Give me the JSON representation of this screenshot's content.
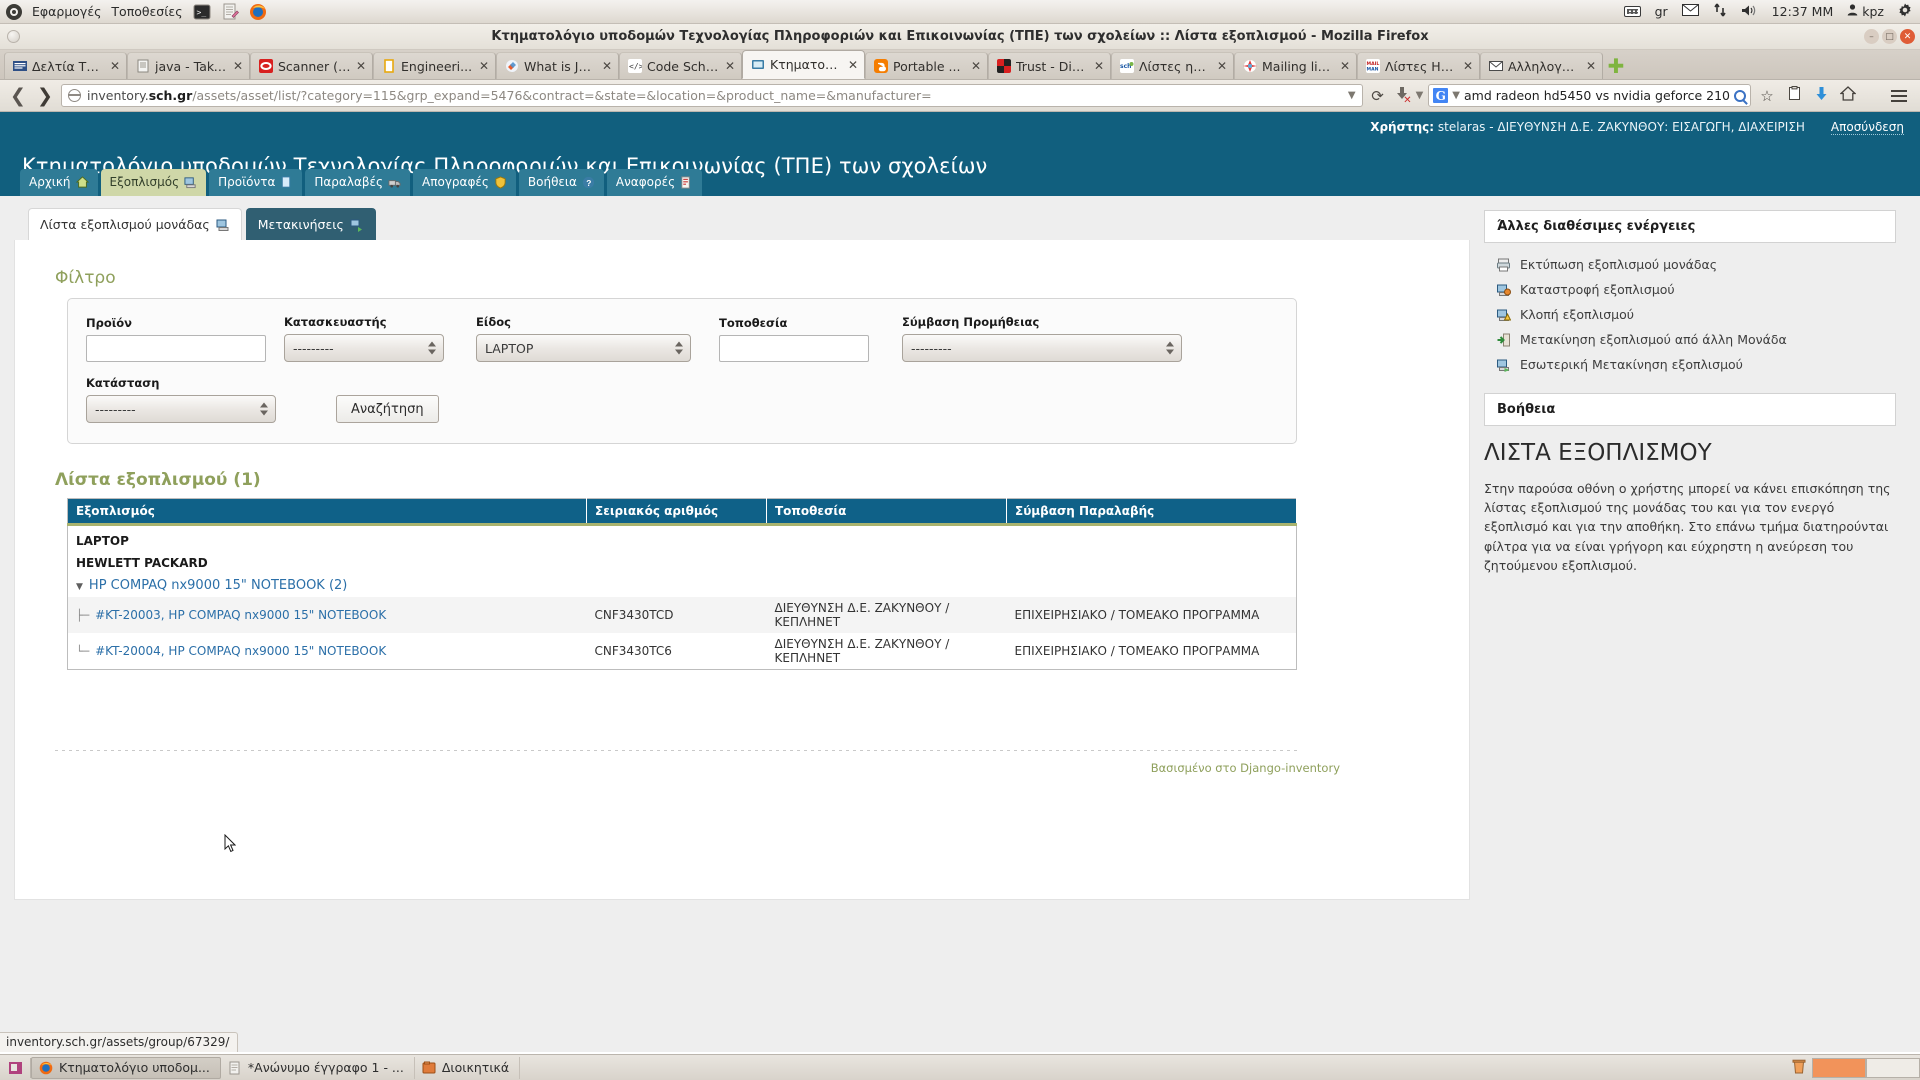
{
  "desktop": {
    "panel": {
      "menus": [
        "Εφαρμογές",
        "Τοποθεσίες"
      ],
      "launchers": [
        {
          "name": "terminal-launcher",
          "label": "Terminal"
        },
        {
          "name": "text-editor-launcher",
          "label": "Text Editor"
        },
        {
          "name": "firefox-launcher",
          "label": "Firefox"
        }
      ],
      "tray": {
        "keyboard_icon": "keyboard-icon",
        "layout": "gr",
        "mail_icon": "mail-icon",
        "network_icon": "network-icon",
        "volume_icon": "volume-icon",
        "clock": "12:37 ΜΜ",
        "user": "kpz",
        "settings_icon": "gear-icon"
      }
    },
    "taskbar": {
      "show_desktop_label": "Show Desktop",
      "items": [
        {
          "label": "Κτηματολόγιο υποδομ...",
          "icon": "firefox-icon",
          "active": true
        },
        {
          "label": "*Ανώνυμο έγγραφο 1 - ...",
          "icon": "text-editor-icon",
          "active": false
        },
        {
          "label": "Διοικητικά",
          "icon": "folder-icon",
          "active": false
        }
      ],
      "workspaces": 2,
      "trash_icon": "trash-icon"
    }
  },
  "browser": {
    "window_title": "Κτηματολόγιο υποδομών Τεχνολογίας Πληροφοριών και Επικοινωνίας (ΤΠΕ) των σχολείων :: Λίστα εξοπλισμού - Mozilla Firefox",
    "window_buttons": {
      "minimize": "–",
      "maximize": "□",
      "close": "✕"
    },
    "tabs": [
      {
        "label": "Δελτία Τε...",
        "favicon": "news-icon",
        "active": false
      },
      {
        "label": "java - Take...",
        "favicon": "doc-icon",
        "active": false
      },
      {
        "label": "Scanner (J...",
        "favicon": "oracle-icon",
        "active": false
      },
      {
        "label": "Engineeri...",
        "favicon": "book-icon",
        "active": false
      },
      {
        "label": "What is Jo...",
        "favicon": "joomla-icon",
        "active": false
      },
      {
        "label": "Code School -...",
        "favicon": "code-icon",
        "active": false
      },
      {
        "label": "Κτηματολόγι...",
        "favicon": "inventory-icon",
        "active": true
      },
      {
        "label": "Portable ...",
        "favicon": "blogger-icon",
        "active": false
      },
      {
        "label": "Trust - Dig...",
        "favicon": "trust-icon",
        "active": false
      },
      {
        "label": "Λίστες ηλε...",
        "favicon": "sch-icon",
        "active": false
      },
      {
        "label": "Mailing lis...",
        "favicon": "mailing-icon",
        "active": false
      },
      {
        "label": "Λίστες Ηλ...",
        "favicon": "mailman-icon",
        "active": false
      },
      {
        "label": "Αλληλογρ...",
        "favicon": "envelope-icon",
        "active": false
      }
    ],
    "tab_close_glyph": "✕",
    "new_tab_glyph": "✚",
    "nav": {
      "back_glyph": "❮",
      "forward_glyph": "❯",
      "reload_glyph": "⟳",
      "stop_glyph": "⬇",
      "bookmark_glyph": "☆",
      "library_glyph": "🗐",
      "download_glyph": "⬇",
      "home_glyph": "⌂",
      "menu_name": "hamburger-menu"
    },
    "url": {
      "scheme_host_prefix": "inventory.",
      "host_strong": "sch.gr",
      "path": "/assets/asset/list/?category=115&grp_expand=5476&contract=&state=&location=&product_name=&manufacturer="
    },
    "search": {
      "engine": "G",
      "value": "amd radeon hd5450 vs nvidia geforce 210",
      "placeholder": "Αναζήτηση"
    },
    "status_bar": "inventory.sch.gr/assets/group/67329/"
  },
  "app": {
    "site_title": "Κτηματολόγιο υποδομών Τεχνολογίας Πληροφοριών και Επικοινωνίας (ΤΠΕ) των σχολείων",
    "user_bar": {
      "label": "Χρήστης:",
      "value": "stelaras - ΔΙΕΥΘΥΝΣΗ Δ.Ε. ΖΑΚΥΝΘΟΥ: ΕΙΣΑΓΩΓΗ, ΔΙΑΧΕΙΡΙΣΗ",
      "logout": "Αποσύνδεση"
    },
    "main_nav": [
      {
        "label": "Αρχική",
        "icon": "home-icon",
        "active": false
      },
      {
        "label": "Εξοπλισμός",
        "icon": "computer-icon",
        "active": true
      },
      {
        "label": "Προϊόντα",
        "icon": "page-icon",
        "active": false
      },
      {
        "label": "Παραλαβές",
        "icon": "truck-icon",
        "active": false
      },
      {
        "label": "Απογραφές",
        "icon": "shield-icon",
        "active": false
      },
      {
        "label": "Βοήθεια",
        "icon": "question-icon",
        "active": false
      },
      {
        "label": "Αναφορές",
        "icon": "report-icon",
        "active": false
      }
    ],
    "sub_tabs": [
      {
        "label": "Λίστα εξοπλισμού μονάδας",
        "icon": "computer-icon",
        "active": true
      },
      {
        "label": "Μετακινήσεις",
        "icon": "transfer-icon",
        "active": false
      }
    ],
    "filter": {
      "title": "Φίλτρο",
      "fields": [
        {
          "name": "product",
          "label": "Προϊόν",
          "type": "text",
          "value": "",
          "placeholder": ""
        },
        {
          "name": "manufacturer",
          "label": "Κατασκευαστής",
          "type": "select",
          "value": "---------"
        },
        {
          "name": "kind",
          "label": "Είδος",
          "type": "select",
          "value": "LAPTOP"
        },
        {
          "name": "location",
          "label": "Τοποθεσία",
          "type": "text",
          "value": "",
          "placeholder": ""
        },
        {
          "name": "supply_contract",
          "label": "Σύμβαση Προμήθειας",
          "type": "select",
          "value": "---------"
        },
        {
          "name": "state",
          "label": "Κατάσταση",
          "type": "select",
          "value": "---------"
        }
      ],
      "search_button": "Αναζήτηση"
    },
    "results": {
      "title": "Λίστα εξοπλισμού (1)",
      "columns": [
        "Εξοπλισμός",
        "Σειριακός αριθμός",
        "Τοποθεσία",
        "Σύμβαση Παραλαβής"
      ],
      "category": "LAPTOP",
      "manufacturer": "HEWLETT PACKARD",
      "product_group": "HP COMPAQ nx9000 15\" NOTEBOOK (2)",
      "rows": [
        {
          "equipment": "#KT-20003, HP COMPAQ nx9000 15\" NOTEBOOK",
          "serial": "CNF3430TCD",
          "location": "ΔΙΕΥΘΥΝΣΗ Δ.Ε. ΖΑΚΥΝΘΟΥ / ΚΕΠΛΗΝΕΤ",
          "contract": "ΕΠΙΧΕΙΡΗΣΙΑΚΟ / ΤΟΜΕΑΚΟ ΠΡΟΓΡΑΜΜΑ"
        },
        {
          "equipment": "#KT-20004, HP COMPAQ nx9000 15\" NOTEBOOK",
          "serial": "CNF3430TC6",
          "location": "ΔΙΕΥΘΥΝΣΗ Δ.Ε. ΖΑΚΥΝΘΟΥ / ΚΕΠΛΗΝΕΤ",
          "contract": "ΕΠΙΧΕΙΡΗΣΙΑΚΟ / ΤΟΜΕΑΚΟ ΠΡΟΓΡΑΜΜΑ"
        }
      ]
    },
    "footer": "Βασισμένο στο Django-inventory",
    "sidebar": {
      "actions_title": "Άλλες διαθέσιμες ενέργειες",
      "actions": [
        {
          "label": "Εκτύπωση εξοπλισμού μονάδας",
          "icon": "printer-icon"
        },
        {
          "label": "Καταστροφή εξοπλισμού",
          "icon": "computer-delete-icon"
        },
        {
          "label": "Κλοπή εξοπλισμού",
          "icon": "computer-warning-icon"
        },
        {
          "label": "Μετακίνηση εξοπλισμού από άλλη Μονάδα",
          "icon": "import-icon"
        },
        {
          "label": "Εσωτερική Μετακίνηση εξοπλισμού",
          "icon": "computer-move-icon"
        }
      ],
      "help_title": "Βοήθεια",
      "help_heading": "ΛΙΣΤΑ ΕΞΟΠΛΙΣΜΟΥ",
      "help_text": "Στην παρούσα οθόνη ο χρήστης μπορεί να κάνει επισκόπηση της λίστας εξοπλισμού της μονάδας του και για τον ενεργό εξοπλισμό και για την αποθήκη. Στο επάνω τμήμα διατηρούνται φίλτρα για να είναι γρήγορη και εύχρηστη η ανεύρεση του ζητούμενου εξοπλισμού."
    },
    "colors": {
      "header_blue": "#115f7e",
      "table_header_blue": "#0f6188",
      "accent_olive": "#8fa05c",
      "active_tab_green": "#cfd7a8",
      "link_blue": "#2b6fa8"
    }
  }
}
